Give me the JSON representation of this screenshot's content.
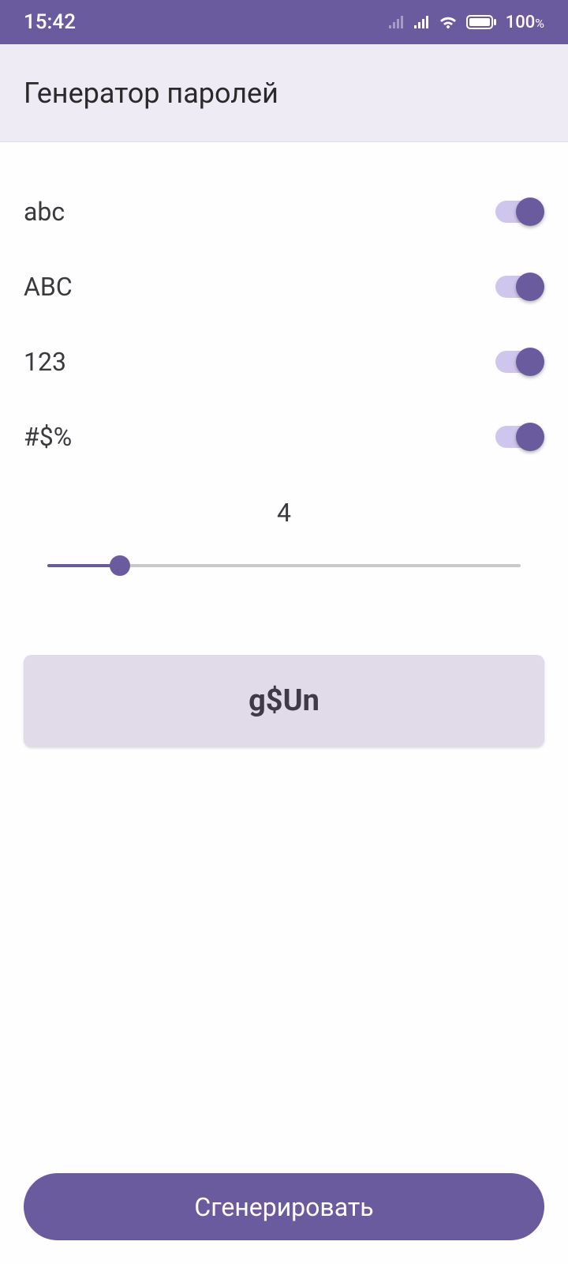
{
  "statusBar": {
    "time": "15:42",
    "battery": "100",
    "batteryPercent": "%"
  },
  "header": {
    "title": "Генератор паролей"
  },
  "options": [
    {
      "label": "abc",
      "enabled": true
    },
    {
      "label": "ABC",
      "enabled": true
    },
    {
      "label": "123",
      "enabled": true
    },
    {
      "label": "#$%",
      "enabled": true
    }
  ],
  "length": {
    "value": "4"
  },
  "password": {
    "generated": "g$Un"
  },
  "actions": {
    "generateLabel": "Сгенерировать"
  }
}
